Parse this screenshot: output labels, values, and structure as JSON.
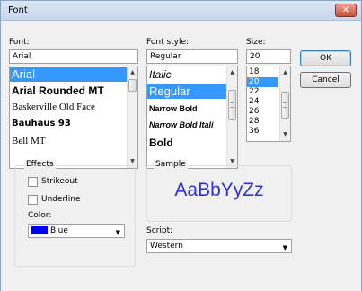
{
  "window": {
    "title": "Font",
    "close_glyph": "✕"
  },
  "font": {
    "label": "Font:",
    "value": "Arial",
    "items": [
      "Arial",
      "Arial Rounded MT",
      "Baskerville Old Face",
      "Bauhaus 93",
      "Bell MT"
    ],
    "selected_index": 0
  },
  "style": {
    "label": "Font style:",
    "value": "Regular",
    "items": [
      "Italic",
      "Regular",
      "Narrow Bold",
      "Narrow Bold Itali",
      "Bold"
    ],
    "selected_index": 1
  },
  "size": {
    "label": "Size:",
    "value": "20",
    "items": [
      "18",
      "20",
      "22",
      "24",
      "26",
      "28",
      "36"
    ],
    "selected_index": 1
  },
  "buttons": {
    "ok": "OK",
    "cancel": "Cancel"
  },
  "effects": {
    "label": "Effects",
    "strikeout": "Strikeout",
    "underline": "Underline",
    "color_label": "Color:",
    "color_value": "Blue",
    "color_hex": "#0000ff"
  },
  "sample": {
    "label": "Sample",
    "text": "AaBbYyZz",
    "color": "#3333cc"
  },
  "script": {
    "label": "Script:",
    "value": "Western"
  },
  "icons": {
    "scroll_up": "▲",
    "scroll_down": "▼",
    "dropdown": "▼"
  }
}
